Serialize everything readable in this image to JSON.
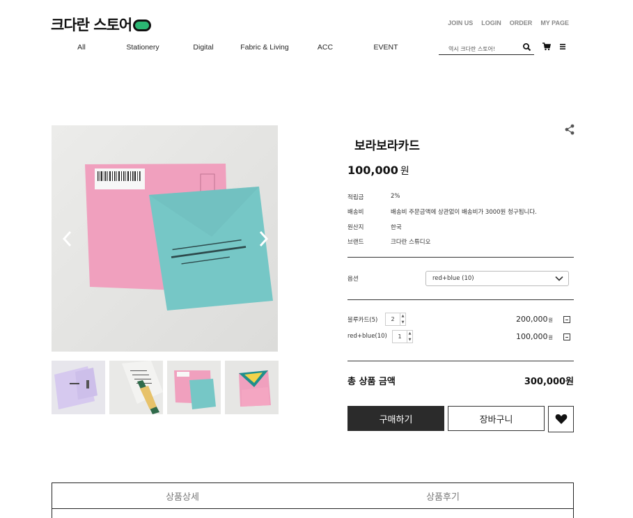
{
  "header": {
    "logo_text": "크다란 스토어",
    "util_links": [
      "JOIN US",
      "LOGIN",
      "ORDER",
      "MY PAGE"
    ],
    "nav": [
      "All",
      "Stationery",
      "Digital",
      "Fabric & Living",
      "ACC",
      "EVENT"
    ],
    "search_placeholder": "역시 크다란 스토어!"
  },
  "product": {
    "title": "보라보라카드",
    "price": "100,000",
    "price_unit": "원",
    "info": [
      {
        "label": "적립금",
        "value": "2%"
      },
      {
        "label": "배송비",
        "value": "배송비 주문금액에 상관없이 배송비가 3000원 청구됩니다."
      },
      {
        "label": "원산지",
        "value": "한국"
      },
      {
        "label": "브랜드",
        "value": "크다란 스튜디오"
      }
    ],
    "option_label": "옵션",
    "option_selected": "red+blue (10)",
    "selected_items": [
      {
        "name": "블루카드(5)",
        "qty": "2",
        "amount": "200,000",
        "unit": "원"
      },
      {
        "name": "red+blue(10)",
        "qty": "1",
        "amount": "100,000",
        "unit": "원"
      }
    ],
    "total_label": "총 상품 금액",
    "total_value": "300,000원",
    "buy_label": "구매하기",
    "cart_label": "장바구니"
  },
  "tabs": [
    "상품상세",
    "상품후기"
  ],
  "colors": {
    "buy_button": "#2b2b2b",
    "logo_accent": "#2bb673",
    "envelope_pink": "#ef9ab8",
    "envelope_teal": "#6cc4c4",
    "envelope_lavender": "#d9cdf0"
  },
  "icons": [
    "search-icon",
    "cart-icon",
    "menu-icon",
    "share-icon",
    "chevron-left-icon",
    "chevron-right-icon",
    "chevron-down-icon",
    "heart-icon",
    "minus-icon"
  ]
}
